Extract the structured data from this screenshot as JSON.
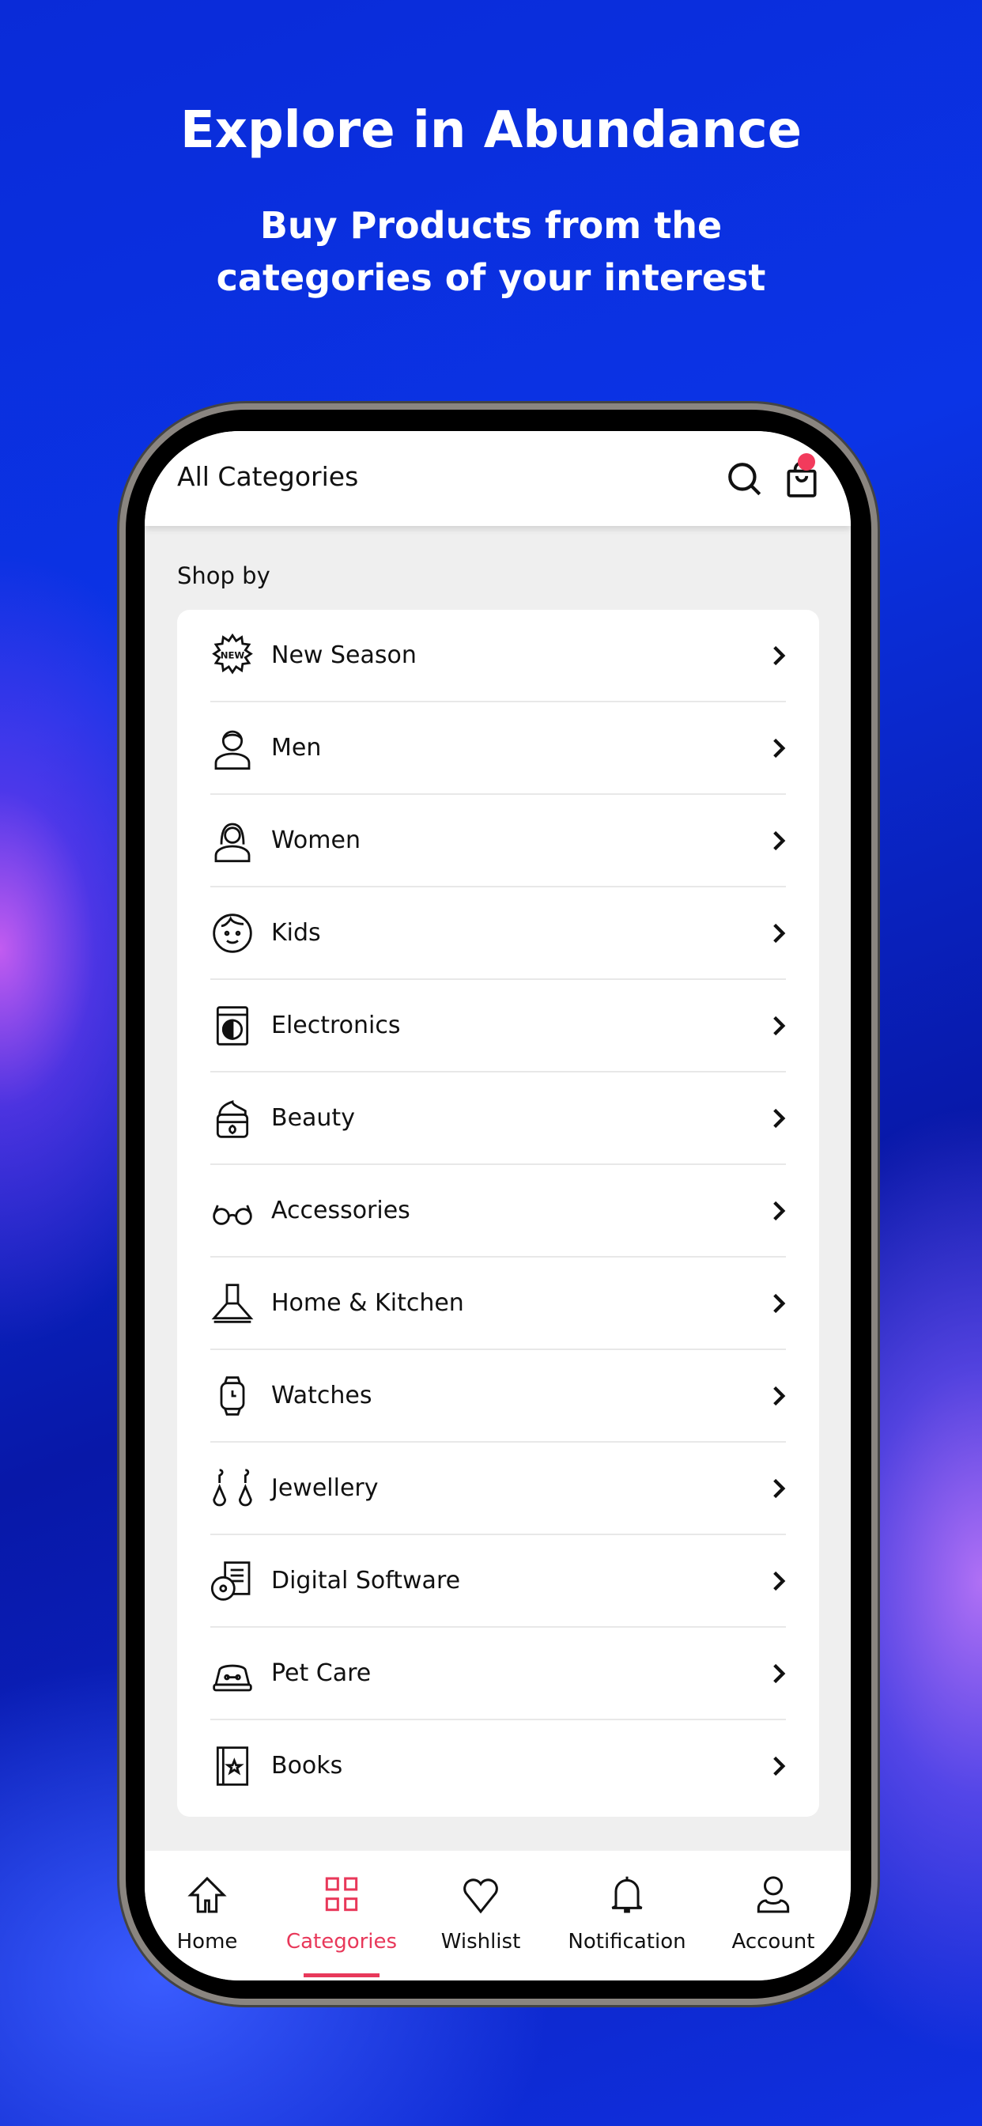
{
  "hero": {
    "title": "Explore in Abundance",
    "subtitle_line1": "Buy Products from the",
    "subtitle_line2": "categories of your interest"
  },
  "header": {
    "title": "All Categories",
    "icons": [
      "search-icon",
      "shopping-bag-icon"
    ],
    "cart_badge_color": "#f23b5c"
  },
  "section": {
    "title": "Shop by"
  },
  "categories": [
    {
      "label": "New Season",
      "icon": "new-badge-icon"
    },
    {
      "label": "Men",
      "icon": "man-icon"
    },
    {
      "label": "Women",
      "icon": "woman-icon"
    },
    {
      "label": "Kids",
      "icon": "kid-face-icon"
    },
    {
      "label": "Electronics",
      "icon": "washing-machine-icon"
    },
    {
      "label": "Beauty",
      "icon": "cream-jar-icon"
    },
    {
      "label": "Accessories",
      "icon": "glasses-icon"
    },
    {
      "label": "Home & Kitchen",
      "icon": "chimney-hood-icon"
    },
    {
      "label": "Watches",
      "icon": "watch-icon"
    },
    {
      "label": "Jewellery",
      "icon": "earrings-icon"
    },
    {
      "label": "Digital Software",
      "icon": "software-disc-icon"
    },
    {
      "label": "Pet Care",
      "icon": "pet-bowl-icon"
    },
    {
      "label": "Books",
      "icon": "book-icon"
    }
  ],
  "nav": {
    "active": "Categories",
    "accent": "#e8385a",
    "items": [
      {
        "label": "Home",
        "icon": "home-icon"
      },
      {
        "label": "Categories",
        "icon": "grid-icon"
      },
      {
        "label": "Wishlist",
        "icon": "heart-icon"
      },
      {
        "label": "Notification",
        "icon": "bell-icon"
      },
      {
        "label": "Account",
        "icon": "user-icon"
      }
    ]
  }
}
